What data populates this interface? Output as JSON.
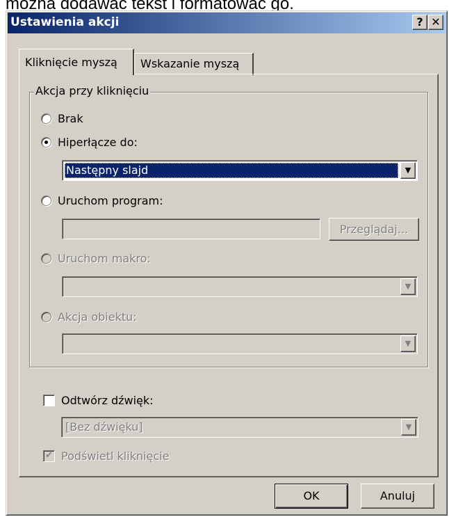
{
  "background_text": "można dodawać tekst i formatować go.",
  "dialog": {
    "title": "Ustawienia akcji",
    "help_glyph": "?",
    "close_glyph": "✕"
  },
  "tabs": [
    {
      "label": "Kliknięcie myszą",
      "active": true
    },
    {
      "label": "Wskazanie myszą",
      "active": false
    }
  ],
  "group": {
    "legend": "Akcja przy kliknięciu",
    "options": {
      "none": {
        "label": "Brak",
        "checked": false,
        "enabled": true
      },
      "hyperlink": {
        "label": "Hiperłącze do:",
        "checked": true,
        "enabled": true,
        "value": "Następny slajd"
      },
      "run_program": {
        "label": "Uruchom program:",
        "checked": false,
        "enabled": true,
        "value": "",
        "browse_label": "Przeglądaj..."
      },
      "run_macro": {
        "label": "Uruchom makro:",
        "checked": false,
        "enabled": false,
        "value": ""
      },
      "object_action": {
        "label": "Akcja obiektu:",
        "checked": false,
        "enabled": false,
        "value": ""
      }
    }
  },
  "sound": {
    "label": "Odtwórz dźwięk:",
    "checked": false,
    "value": "[Bez dźwięku]"
  },
  "highlight": {
    "label": "Podświetl kliknięcie",
    "checked": true,
    "enabled": false
  },
  "buttons": {
    "ok": "OK",
    "cancel": "Anuluj"
  },
  "colors": {
    "face": "#d4d0c8",
    "title_start": "#0a246a",
    "title_end": "#a6caf0",
    "selection": "#0a246a"
  }
}
